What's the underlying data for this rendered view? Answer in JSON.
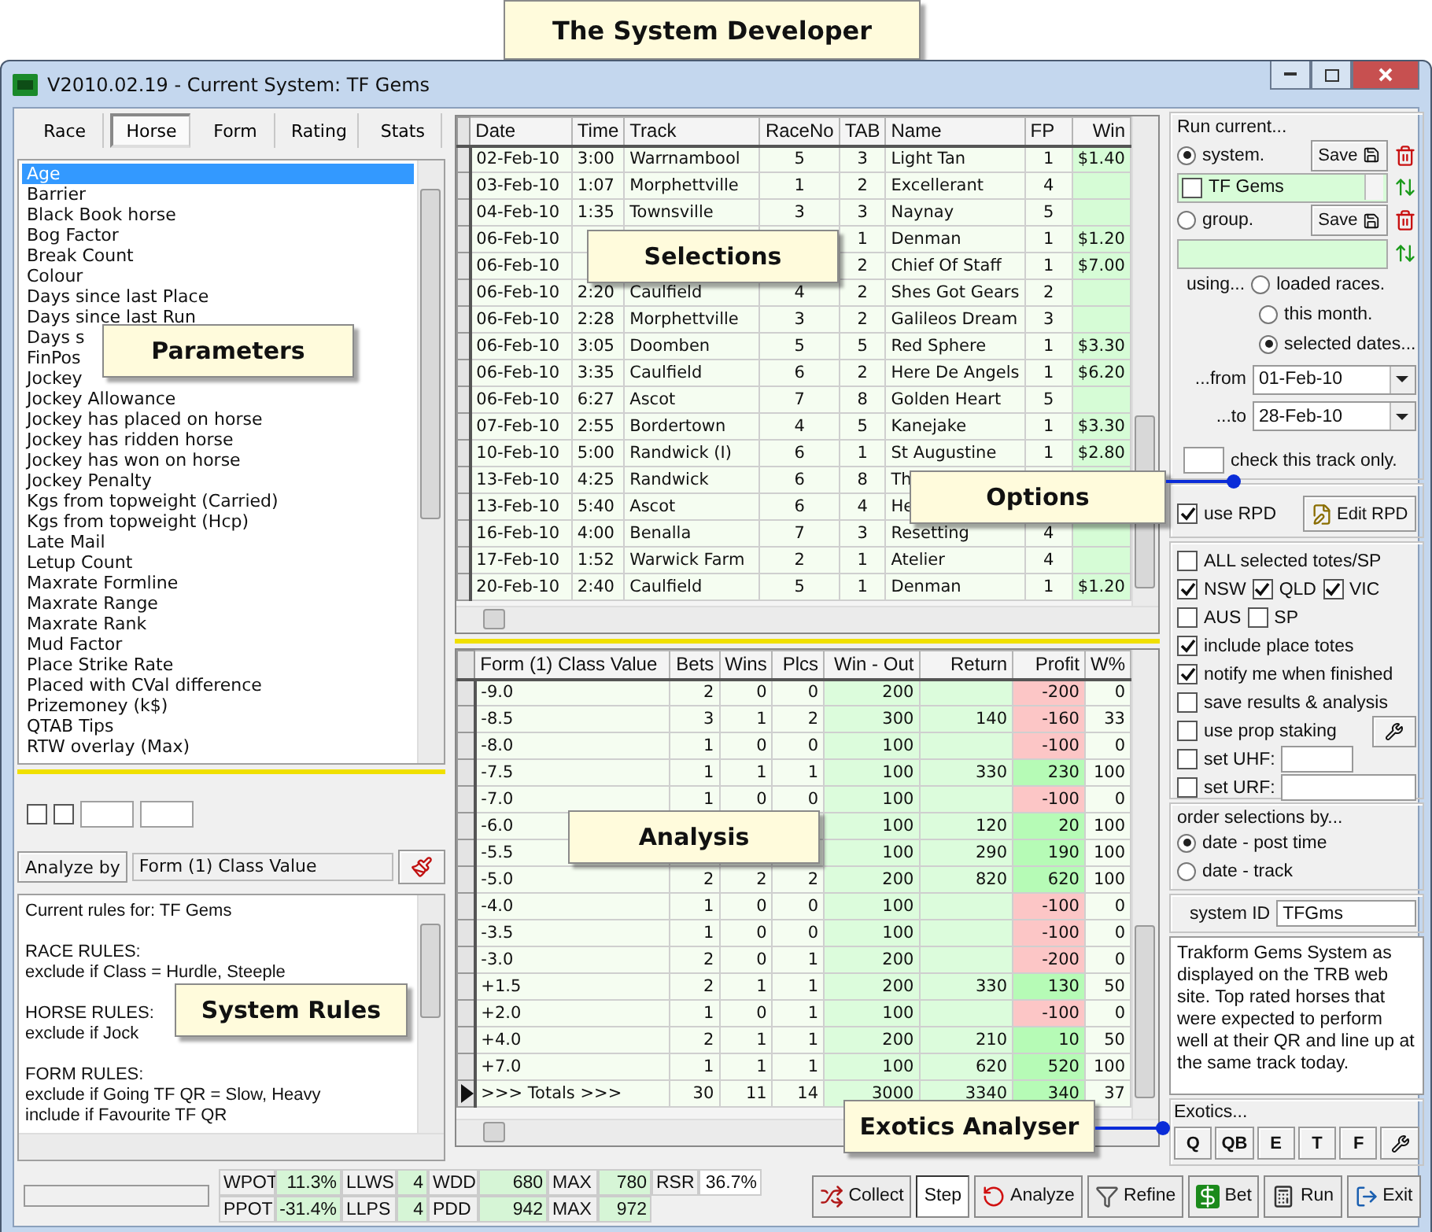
{
  "banner": "The System Developer",
  "window": {
    "title": "V2010.02.19 - Current System: TF Gems"
  },
  "callouts": [
    {
      "label": "Parameters",
      "pointer": false
    },
    {
      "label": "Selections",
      "pointer": false
    },
    {
      "label": "Options",
      "pointer": true
    },
    {
      "label": "Analysis",
      "pointer": false
    },
    {
      "label": "System Rules",
      "pointer": false
    },
    {
      "label": "Exotics Analyser",
      "pointer": true
    }
  ],
  "left_panel": {
    "tabs": [
      {
        "label": "Race",
        "selected": false
      },
      {
        "label": "Horse",
        "selected": true
      },
      {
        "label": "Form",
        "selected": false
      },
      {
        "label": "Rating",
        "selected": false
      },
      {
        "label": "Stats",
        "selected": false
      }
    ],
    "parameters": [
      {
        "label": "Age",
        "selected": true
      },
      {
        "label": "Barrier",
        "selected": false
      },
      {
        "label": "Black Book horse",
        "selected": false
      },
      {
        "label": "Bog Factor",
        "selected": false
      },
      {
        "label": "Break Count",
        "selected": false
      },
      {
        "label": "Colour",
        "selected": false
      },
      {
        "label": "Days since last Place",
        "selected": false
      },
      {
        "label": "Days since last Run",
        "selected": false
      },
      {
        "label": "Days s",
        "selected": false
      },
      {
        "label": "FinPos",
        "selected": false
      },
      {
        "label": "Jockey",
        "selected": false
      },
      {
        "label": "Jockey Allowance",
        "selected": false
      },
      {
        "label": "Jockey has placed on horse",
        "selected": false
      },
      {
        "label": "Jockey has ridden horse",
        "selected": false
      },
      {
        "label": "Jockey has won on horse",
        "selected": false
      },
      {
        "label": "Jockey Penalty",
        "selected": false
      },
      {
        "label": "Kgs from topweight (Carried)",
        "selected": false
      },
      {
        "label": "Kgs from topweight (Hcp)",
        "selected": false
      },
      {
        "label": "Late Mail",
        "selected": false
      },
      {
        "label": "Letup Count",
        "selected": false
      },
      {
        "label": "Maxrate Formline",
        "selected": false
      },
      {
        "label": "Maxrate Range",
        "selected": false
      },
      {
        "label": "Maxrate Rank",
        "selected": false
      },
      {
        "label": "Mud Factor",
        "selected": false
      },
      {
        "label": "Place Strike Rate",
        "selected": false
      },
      {
        "label": "Placed with CVal difference",
        "selected": false
      },
      {
        "label": "Prizemoney (k$)",
        "selected": false
      },
      {
        "label": "QTAB Tips",
        "selected": false
      },
      {
        "label": "RTW overlay (Max)",
        "selected": false
      }
    ],
    "filters": [
      {
        "checked": false
      },
      {
        "checked": false
      }
    ],
    "analyze_by": {
      "button": "Analyze by",
      "value": "Form (1) Class Value"
    },
    "rules": {
      "intro": "Current rules for: TF Gems",
      "sections": [
        {
          "title": "RACE RULES:",
          "lines": [
            "exclude if Class = Hurdle, Steeple"
          ]
        },
        {
          "title": "HORSE RULES:",
          "lines": [
            "exclude if Jock"
          ]
        },
        {
          "title": "FORM RULES:",
          "lines": [
            "exclude if Going TF QR = Slow, Heavy",
            "include if Favourite TF QR"
          ]
        }
      ]
    }
  },
  "selections": {
    "columns": [
      "Date",
      "Time",
      "Track",
      "RaceNo",
      "TAB",
      "Name",
      "FP",
      "Win"
    ],
    "rows": [
      {
        "date": "02-Feb-10",
        "time": "3:00",
        "track": "Warrnambool",
        "race_no": "5",
        "tab": "3",
        "name": "Light Tan",
        "fp": "1",
        "win": "$1.40"
      },
      {
        "date": "03-Feb-10",
        "time": "1:07",
        "track": "Morphettville",
        "race_no": "1",
        "tab": "2",
        "name": "Excellerant",
        "fp": "4"
      },
      {
        "date": "04-Feb-10",
        "time": "1:35",
        "track": "Townsville",
        "race_no": "3",
        "tab": "3",
        "name": "Naynay",
        "fp": "5"
      },
      {
        "date": "06-Feb-10",
        "tab": "1",
        "name": "Denman",
        "fp": "1",
        "win": "$1.20"
      },
      {
        "date": "06-Feb-10",
        "tab": "2",
        "name": "Chief Of Staff",
        "fp": "1",
        "win": "$7.00"
      },
      {
        "date": "06-Feb-10",
        "time": "2:20",
        "track": "Caulfield",
        "race_no": "4",
        "tab": "2",
        "name": "Shes Got Gears",
        "fp": "2"
      },
      {
        "date": "06-Feb-10",
        "time": "2:28",
        "track": "Morphettville",
        "race_no": "3",
        "tab": "2",
        "name": "Galileos Dream",
        "fp": "3"
      },
      {
        "date": "06-Feb-10",
        "time": "3:05",
        "track": "Doomben",
        "race_no": "5",
        "tab": "5",
        "name": "Red Sphere",
        "fp": "1",
        "win": "$3.30"
      },
      {
        "date": "06-Feb-10",
        "time": "3:35",
        "track": "Caulfield",
        "race_no": "6",
        "tab": "2",
        "name": "Here De Angels",
        "fp": "1",
        "win": "$6.20"
      },
      {
        "date": "06-Feb-10",
        "time": "6:27",
        "track": "Ascot",
        "race_no": "7",
        "tab": "8",
        "name": "Golden Heart",
        "fp": "5"
      },
      {
        "date": "07-Feb-10",
        "time": "2:55",
        "track": "Bordertown",
        "race_no": "4",
        "tab": "5",
        "name": "Kanejake",
        "fp": "1",
        "win": "$3.30"
      },
      {
        "date": "10-Feb-10",
        "time": "5:00",
        "track": "Randwick (I)",
        "race_no": "6",
        "tab": "1",
        "name": "St Augustine",
        "fp": "1",
        "win": "$2.80"
      },
      {
        "date": "13-Feb-10",
        "time": "4:25",
        "track": "Randwick",
        "race_no": "6",
        "tab": "8",
        "name": "Th"
      },
      {
        "date": "13-Feb-10",
        "time": "5:40",
        "track": "Ascot",
        "race_no": "6",
        "tab": "4",
        "name": "He"
      },
      {
        "date": "16-Feb-10",
        "time": "4:00",
        "track": "Benalla",
        "race_no": "7",
        "tab": "3",
        "name": "Resetting",
        "fp": "4"
      },
      {
        "date": "17-Feb-10",
        "time": "1:52",
        "track": "Warwick Farm",
        "race_no": "2",
        "tab": "1",
        "name": "Atelier",
        "fp": "4"
      },
      {
        "date": "20-Feb-10",
        "time": "2:40",
        "track": "Caulfield",
        "race_no": "5",
        "tab": "1",
        "name": "Denman",
        "fp": "1",
        "win": "$1.20"
      }
    ]
  },
  "analysis": {
    "columns": [
      "Form (1) Class Value",
      "Bets",
      "Wins",
      "Plcs",
      "Win - Out",
      "Return",
      "Profit",
      "W%"
    ],
    "rows": [
      {
        "value": "-9.0",
        "bets": "2",
        "wins": "0",
        "plcs": "0",
        "win_out": "200",
        "profit": "-200",
        "w_pct": "0",
        "profitable": false,
        "selected": false
      },
      {
        "value": "-8.5",
        "bets": "3",
        "wins": "1",
        "plcs": "2",
        "win_out": "300",
        "return": "140",
        "profit": "-160",
        "w_pct": "33",
        "profitable": false,
        "selected": false
      },
      {
        "value": "-8.0",
        "bets": "1",
        "wins": "0",
        "plcs": "0",
        "win_out": "100",
        "profit": "-100",
        "w_pct": "0",
        "profitable": false,
        "selected": false
      },
      {
        "value": "-7.5",
        "bets": "1",
        "wins": "1",
        "plcs": "1",
        "win_out": "100",
        "return": "330",
        "profit": "230",
        "w_pct": "100",
        "profitable": true,
        "selected": false
      },
      {
        "value": "-7.0",
        "bets": "1",
        "wins": "0",
        "plcs": "0",
        "win_out": "100",
        "profit": "-100",
        "w_pct": "0",
        "profitable": false,
        "selected": false
      },
      {
        "value": "-6.0",
        "win_out": "100",
        "return": "120",
        "profit": "20",
        "w_pct": "100",
        "profitable": true,
        "selected": false
      },
      {
        "value": "-5.5",
        "win_out": "100",
        "return": "290",
        "profit": "190",
        "w_pct": "100",
        "profitable": true,
        "selected": false
      },
      {
        "value": "-5.0",
        "bets": "2",
        "wins": "2",
        "plcs": "2",
        "win_out": "200",
        "return": "820",
        "profit": "620",
        "w_pct": "100",
        "profitable": true,
        "selected": false
      },
      {
        "value": "-4.0",
        "bets": "1",
        "wins": "0",
        "plcs": "0",
        "win_out": "100",
        "profit": "-100",
        "w_pct": "0",
        "profitable": false,
        "selected": false
      },
      {
        "value": "-3.5",
        "bets": "1",
        "wins": "0",
        "plcs": "0",
        "win_out": "100",
        "profit": "-100",
        "w_pct": "0",
        "profitable": false,
        "selected": false
      },
      {
        "value": "-3.0",
        "bets": "2",
        "wins": "0",
        "plcs": "1",
        "win_out": "200",
        "profit": "-200",
        "w_pct": "0",
        "profitable": false,
        "selected": false
      },
      {
        "value": "+1.5",
        "bets": "2",
        "wins": "1",
        "plcs": "1",
        "win_out": "200",
        "return": "330",
        "profit": "130",
        "w_pct": "50",
        "profitable": true,
        "selected": false
      },
      {
        "value": "+2.0",
        "bets": "1",
        "wins": "0",
        "plcs": "1",
        "win_out": "100",
        "profit": "-100",
        "w_pct": "0",
        "profitable": false,
        "selected": false
      },
      {
        "value": "+4.0",
        "bets": "2",
        "wins": "1",
        "plcs": "1",
        "win_out": "200",
        "return": "210",
        "profit": "10",
        "w_pct": "50",
        "profitable": true,
        "selected": false
      },
      {
        "value": "+7.0",
        "bets": "1",
        "wins": "1",
        "plcs": "1",
        "win_out": "100",
        "return": "620",
        "profit": "520",
        "w_pct": "100",
        "profitable": true,
        "selected": false
      },
      {
        "value": ">>> Totals >>>",
        "bets": "30",
        "wins": "11",
        "plcs": "14",
        "win_out": "3000",
        "return": "3340",
        "profit": "340",
        "w_pct": "37",
        "profitable": true,
        "selected": true
      }
    ]
  },
  "options": {
    "title": "Run current...",
    "run_targets": [
      {
        "label": "system.",
        "selected": true,
        "save": "Save",
        "name": "TF Gems",
        "checked": false
      },
      {
        "label": "group.",
        "selected": false,
        "save": "Save"
      }
    ],
    "using_label": "using...",
    "using": [
      {
        "label": "loaded races.",
        "selected": false
      },
      {
        "label": "this month.",
        "selected": false
      },
      {
        "label": "selected dates...",
        "selected": true
      }
    ],
    "from": {
      "label": "...from",
      "value": "01-Feb-10"
    },
    "to": {
      "label": "...to",
      "value": "28-Feb-10"
    },
    "track_only": "check this track only.",
    "use_rpd": {
      "label": "use RPD",
      "checked": true
    },
    "edit_rpd": "Edit RPD",
    "check_rows": [
      {
        "items": [
          {
            "label": "ALL selected totes/SP",
            "checked": false,
            "kind": "plain"
          }
        ]
      },
      {
        "items": [
          {
            "label": "NSW",
            "checked": true,
            "kind": "plain"
          },
          {
            "label": "QLD",
            "checked": true,
            "kind": "plain"
          },
          {
            "label": "VIC",
            "checked": true,
            "kind": "plain"
          }
        ]
      },
      {
        "items": [
          {
            "label": "AUS",
            "checked": false,
            "kind": "plain"
          },
          {
            "label": "SP",
            "checked": false,
            "kind": "plain"
          }
        ]
      },
      {
        "items": [
          {
            "label": "include place totes",
            "checked": true,
            "kind": "plain"
          }
        ]
      },
      {
        "items": [
          {
            "label": "notify me when finished",
            "checked": true,
            "kind": "plain"
          }
        ]
      },
      {
        "items": [
          {
            "label": "save results & analysis",
            "checked": false,
            "kind": "plain"
          }
        ]
      },
      {
        "items": [
          {
            "label": "use prop staking",
            "checked": false,
            "kind": "tool"
          }
        ]
      },
      {
        "items": [
          {
            "label": "set UHF:",
            "checked": false,
            "kind": "short_field"
          }
        ]
      },
      {
        "items": [
          {
            "label": "set URF:",
            "checked": false,
            "kind": "long_field"
          }
        ]
      }
    ],
    "order_label": "order selections by...",
    "order": [
      {
        "label": "date - post time",
        "selected": true
      },
      {
        "label": "date - track",
        "selected": false
      }
    ],
    "system_id": {
      "label": "system ID",
      "value": "TFGms"
    },
    "description": "Trakform Gems System as displayed on the TRB web site. Top rated horses that were expected to perform well at their QR and line up at the same track today.",
    "exotics": {
      "label": "Exotics...",
      "buttons": [
        "Q",
        "QB",
        "E",
        "T",
        "F"
      ]
    }
  },
  "status": {
    "progress": {
      "level": 0
    },
    "stats": [
      {
        "items": [
          {
            "label": "WPOT",
            "value": "11.3%",
            "shaded": true
          },
          {
            "label": "LLWS",
            "value": "4",
            "shaded": true
          },
          {
            "label": "WDD",
            "value": "680",
            "shaded": true
          },
          {
            "label": "MAX",
            "value": "780",
            "shaded": true
          },
          {
            "label": "RSR",
            "value": "36.7%",
            "shaded": false
          }
        ]
      },
      {
        "items": [
          {
            "label": "PPOT",
            "value": "-31.4%",
            "shaded": true
          },
          {
            "label": "LLPS",
            "value": "4",
            "shaded": true
          },
          {
            "label": "PDD",
            "value": "942",
            "shaded": true
          },
          {
            "label": "MAX",
            "value": "972",
            "shaded": true
          }
        ]
      }
    ],
    "toolbar": [
      {
        "label": "Collect",
        "kind": "collect",
        "selected": false
      },
      {
        "label": "Step",
        "kind": "step",
        "selected": true
      },
      {
        "label": "Analyze",
        "kind": "analyze",
        "selected": false
      },
      {
        "label": "Refine",
        "kind": "refine",
        "selected": false
      },
      {
        "label": "Bet",
        "kind": "bet",
        "selected": false
      },
      {
        "label": "Run",
        "kind": "run",
        "selected": false
      },
      {
        "label": "Exit",
        "kind": "exit",
        "selected": false
      }
    ]
  }
}
